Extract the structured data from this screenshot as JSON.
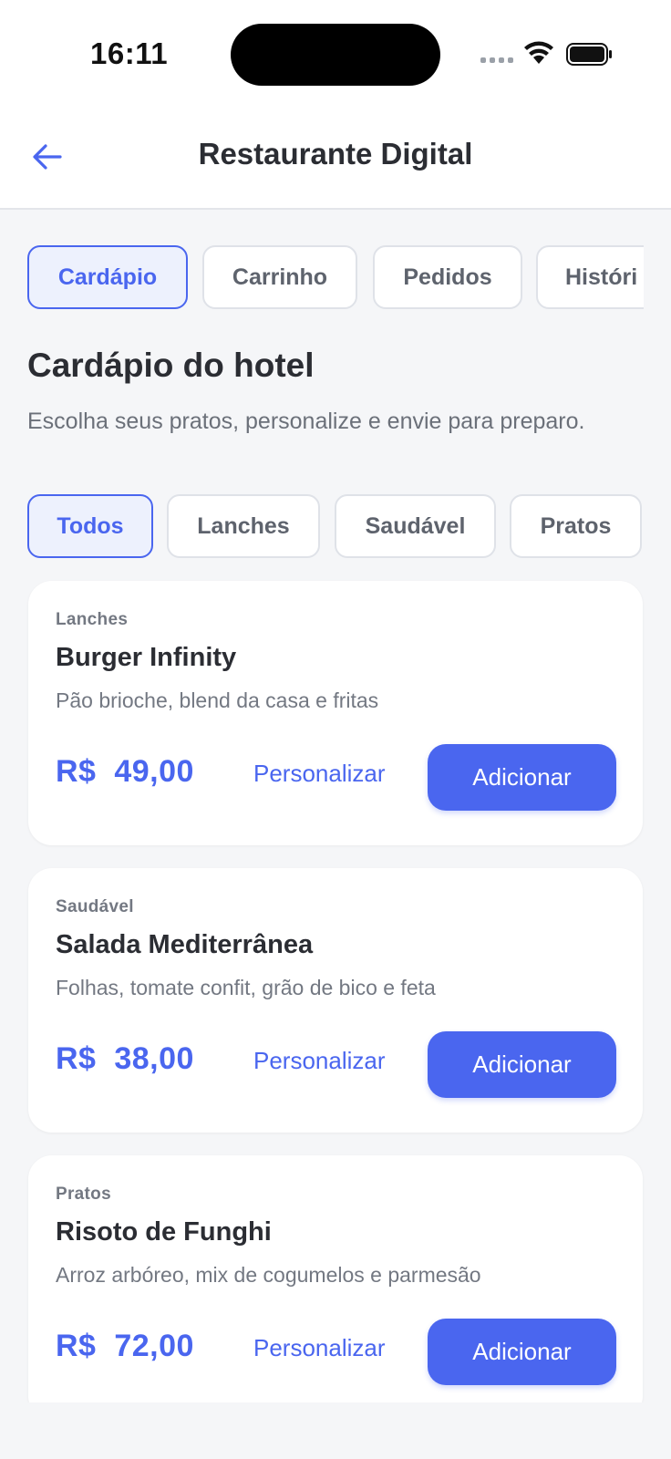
{
  "status": {
    "time": "16:11"
  },
  "nav": {
    "title": "Restaurante Digital",
    "back_icon": "arrow-left-icon"
  },
  "tabs": [
    {
      "label": "Cardápio",
      "active": true
    },
    {
      "label": "Carrinho",
      "active": false
    },
    {
      "label": "Pedidos",
      "active": false
    },
    {
      "label": "Históri",
      "active": false
    }
  ],
  "menu": {
    "title": "Cardápio do hotel",
    "subtitle": "Escolha seus pratos, personalize e envie para preparo."
  },
  "filters": [
    {
      "label": "Todos",
      "active": true
    },
    {
      "label": "Lanches",
      "active": false
    },
    {
      "label": "Saudável",
      "active": false
    },
    {
      "label": "Pratos",
      "active": false
    }
  ],
  "items": [
    {
      "category": "Lanches",
      "name": "Burger Infinity",
      "description": "Pão brioche, blend da casa e fritas",
      "price": "R$  49,00",
      "customize_label": "Personalizar",
      "add_label": "Adicionar"
    },
    {
      "category": "Saudável",
      "name": "Salada Mediterrânea",
      "description": "Folhas, tomate confit, grão de bico e feta",
      "price": "R$  38,00",
      "customize_label": "Personalizar",
      "add_label": "Adicionar"
    },
    {
      "category": "Pratos",
      "name": "Risoto de Funghi",
      "description": "Arroz arbóreo, mix de cogumelos e parmesão",
      "price": "R$  72,00",
      "customize_label": "Personalizar",
      "add_label": "Adicionar"
    }
  ],
  "colors": {
    "accent": "#4a66ef",
    "background": "#f5f6f8",
    "text": "#2b2d33",
    "muted": "#737882"
  }
}
